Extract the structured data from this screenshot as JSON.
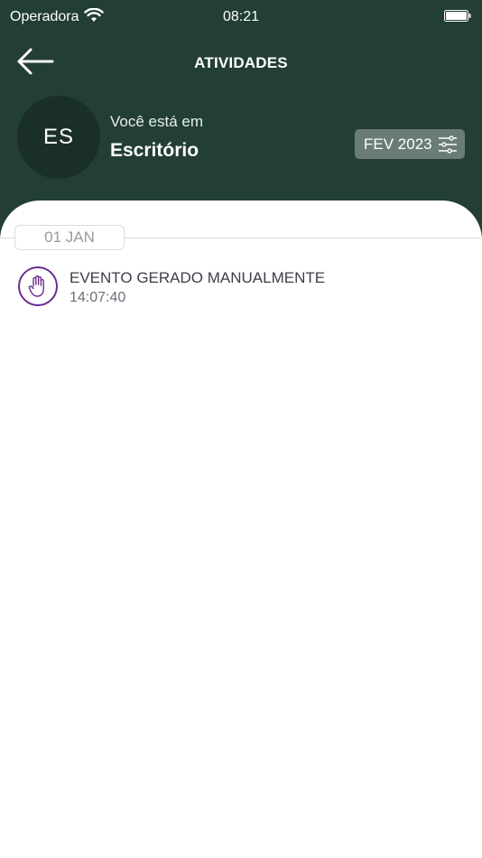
{
  "status_bar": {
    "carrier": "Operadora",
    "time": "08:21"
  },
  "nav": {
    "title": "ATIVIDADES"
  },
  "location": {
    "initials": "ES",
    "label": "Você está em",
    "name": "Escritório"
  },
  "filter": {
    "period": "FEV 2023",
    "icon": "sliders-icon"
  },
  "activities": [
    {
      "date": "01 JAN",
      "events": [
        {
          "title": "EVENTO GERADO MANUALMENTE",
          "time": "14:07:40",
          "icon": "hand-icon"
        }
      ]
    }
  ],
  "colors": {
    "header_bg": "#223e35",
    "avatar_bg": "#1a2f28",
    "accent": "#6a2c91",
    "filter_bg": "#6b7c76"
  }
}
